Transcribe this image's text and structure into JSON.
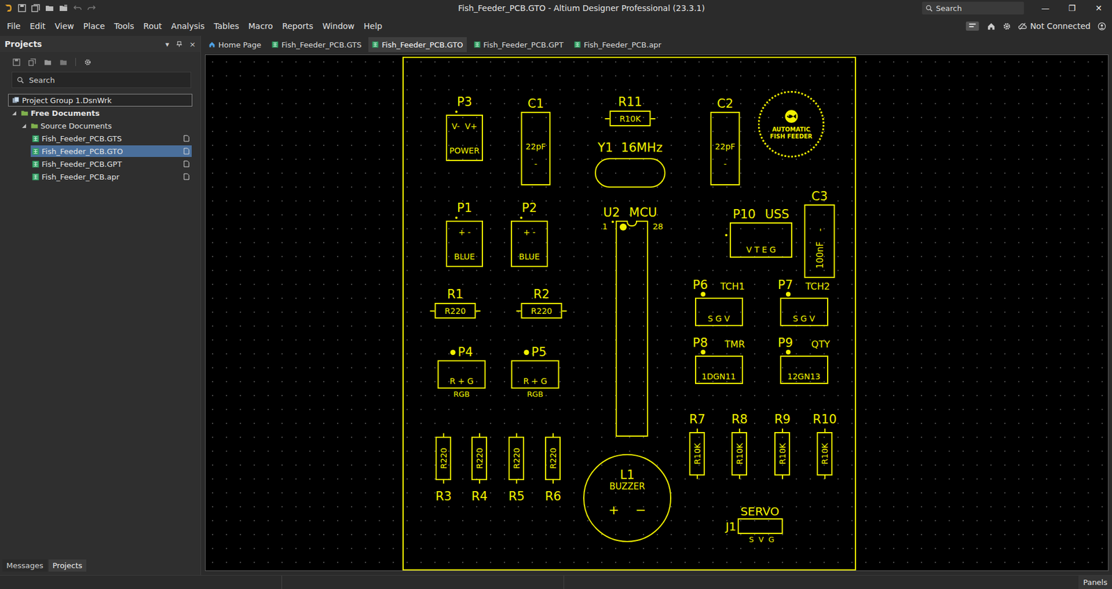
{
  "window": {
    "title": "Fish_Feeder_PCB.GTO - Altium Designer Professional (23.3.1)",
    "search_placeholder": "Search",
    "controls": [
      "—",
      "❐",
      "✕"
    ]
  },
  "menu": [
    "File",
    "Edit",
    "View",
    "Place",
    "Tools",
    "Rout",
    "Analysis",
    "Tables",
    "Macro",
    "Reports",
    "Window",
    "Help"
  ],
  "account": {
    "status": "Not Connected"
  },
  "projects_panel": {
    "title": "Projects",
    "controls": [
      "▾",
      "×"
    ],
    "search_placeholder": "Search",
    "tree": [
      {
        "label": "Project Group 1.DsnWrk",
        "level": 0,
        "kind": "group",
        "selected": false,
        "focused": true
      },
      {
        "label": "Free Documents",
        "level": 0,
        "kind": "root",
        "expanded": true,
        "selected": false,
        "focused": false
      },
      {
        "label": "Source Documents",
        "level": 1,
        "kind": "folder",
        "expanded": true,
        "selected": false,
        "focused": false
      },
      {
        "label": "Fish_Feeder_PCB.GTS",
        "level": 2,
        "kind": "file",
        "selected": false,
        "focused": false
      },
      {
        "label": "Fish_Feeder_PCB.GTO",
        "level": 2,
        "kind": "file",
        "selected": true,
        "focused": false
      },
      {
        "label": "Fish_Feeder_PCB.GPT",
        "level": 2,
        "kind": "file",
        "selected": false,
        "focused": false
      },
      {
        "label": "Fish_Feeder_PCB.apr",
        "level": 2,
        "kind": "file",
        "selected": false,
        "focused": false
      }
    ]
  },
  "panel_tabs": [
    {
      "label": "Messages",
      "selected": false
    },
    {
      "label": "Projects",
      "selected": true
    }
  ],
  "doc_tabs": [
    {
      "label": "Home Page",
      "kind": "home",
      "selected": false
    },
    {
      "label": "Fish_Feeder_PCB.GTS",
      "kind": "pcb",
      "selected": false
    },
    {
      "label": "Fish_Feeder_PCB.GTO",
      "kind": "pcb",
      "selected": true
    },
    {
      "label": "Fish_Feeder_PCB.GPT",
      "kind": "pcb",
      "selected": false
    },
    {
      "label": "Fish_Feeder_PCB.apr",
      "kind": "pcb",
      "selected": false
    }
  ],
  "board": {
    "components": [
      {
        "ref": "P3",
        "kind": "header",
        "lines": [
          "V-  V+",
          "POWER"
        ]
      },
      {
        "ref": "C1",
        "kind": "cap",
        "value": "22pF",
        "mark": "-"
      },
      {
        "ref": "R11",
        "kind": "res-h",
        "value": "R10K"
      },
      {
        "ref": "Y1",
        "kind": "crystal",
        "tag": "16MHz"
      },
      {
        "ref": "C2",
        "kind": "cap",
        "value": "22pF",
        "mark": "-"
      },
      {
        "ref": "",
        "kind": "logo",
        "lines": [
          "AUTOMATIC",
          "FISH FEEDER"
        ]
      },
      {
        "ref": "P1",
        "kind": "header",
        "lines": [
          "+ -",
          "BLUE"
        ]
      },
      {
        "ref": "P2",
        "kind": "header",
        "lines": [
          "+ -",
          "BLUE"
        ]
      },
      {
        "ref": "U2",
        "kind": "ic",
        "tag": "MCU",
        "pin_first": "1",
        "pin_last": "28"
      },
      {
        "ref": "P10",
        "kind": "header-wide",
        "tag": "USS",
        "lines": [
          "V T E G"
        ]
      },
      {
        "ref": "C3",
        "kind": "cap-rot",
        "value": "100nF",
        "mark": "-"
      },
      {
        "ref": "R1",
        "kind": "res-h",
        "value": "R220"
      },
      {
        "ref": "R2",
        "kind": "res-h",
        "value": "R220"
      },
      {
        "ref": "P6",
        "kind": "header-tag",
        "tag": "TCH1",
        "lines": [
          "S G V"
        ]
      },
      {
        "ref": "P7",
        "kind": "header-tag",
        "tag": "TCH2",
        "lines": [
          "S G V"
        ]
      },
      {
        "ref": "P4",
        "kind": "header-dot",
        "lines": [
          "R + G"
        ],
        "caption": "RGB"
      },
      {
        "ref": "P5",
        "kind": "header-dot",
        "lines": [
          "R + G"
        ],
        "caption": "RGB"
      },
      {
        "ref": "P8",
        "kind": "header-tag",
        "tag": "TMR",
        "lines": [
          "1DGN11"
        ]
      },
      {
        "ref": "P9",
        "kind": "header-tag",
        "tag": "QTY",
        "lines": [
          "12GN13"
        ]
      },
      {
        "ref": "R3",
        "kind": "res-v-below",
        "value": "R220"
      },
      {
        "ref": "R4",
        "kind": "res-v-below",
        "value": "R220"
      },
      {
        "ref": "R5",
        "kind": "res-v-below",
        "value": "R220"
      },
      {
        "ref": "R6",
        "kind": "res-v-below",
        "value": "R220"
      },
      {
        "ref": "R7",
        "kind": "res-v-above",
        "value": "R10K"
      },
      {
        "ref": "R8",
        "kind": "res-v-above",
        "value": "R10K"
      },
      {
        "ref": "R9",
        "kind": "res-v-above",
        "value": "R10K"
      },
      {
        "ref": "R10",
        "kind": "res-v-above",
        "value": "R10K"
      },
      {
        "ref": "L1",
        "kind": "buzzer",
        "tag": "BUZZER",
        "lines": [
          "+",
          "−"
        ]
      },
      {
        "ref": "J1",
        "kind": "servo",
        "tag": "SERVO",
        "caption": "S V G"
      }
    ]
  },
  "status_bar": {
    "button": "Panels"
  }
}
